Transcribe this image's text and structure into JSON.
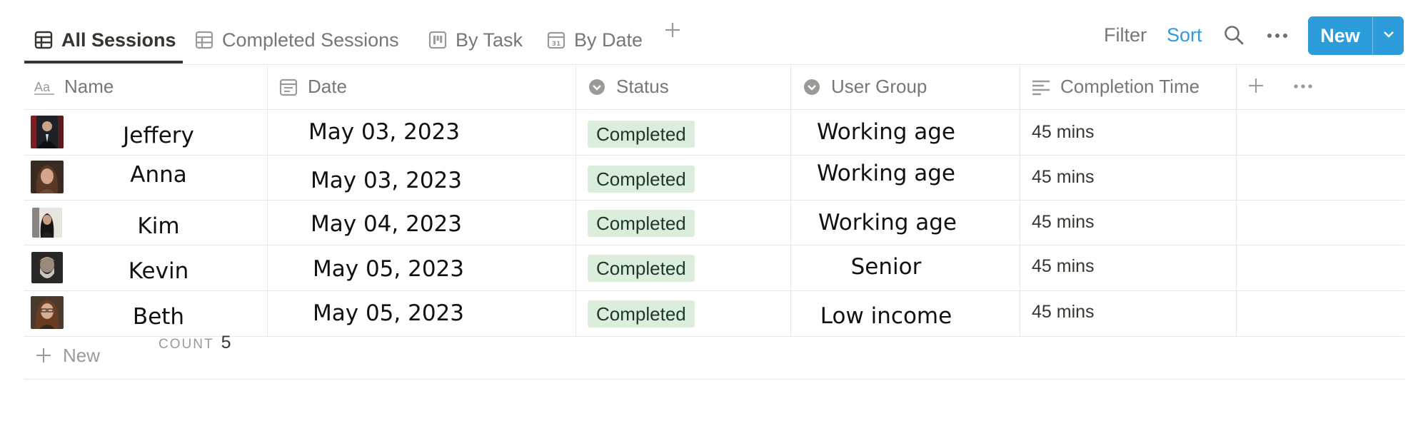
{
  "tabs": [
    {
      "label": "All Sessions",
      "icon": "table-icon",
      "active": true
    },
    {
      "label": "Completed Sessions",
      "icon": "table-icon",
      "active": false
    },
    {
      "label": "By Task",
      "icon": "board-icon",
      "active": false
    },
    {
      "label": "By Date",
      "icon": "calendar-icon",
      "active": false
    }
  ],
  "toolbar": {
    "filter_label": "Filter",
    "sort_label": "Sort",
    "new_label": "New",
    "search_icon": "search-icon",
    "more_icon": "more-icon"
  },
  "columns": [
    {
      "label": "Name",
      "icon": "text-property-icon"
    },
    {
      "label": "Date",
      "icon": "date-property-icon"
    },
    {
      "label": "Status",
      "icon": "status-property-icon"
    },
    {
      "label": "User Group",
      "icon": "select-property-icon"
    },
    {
      "label": "Completion Time",
      "icon": "text-lines-icon"
    }
  ],
  "rows": [
    {
      "name": "Jeffery",
      "date": "May 03, 2023",
      "status": "Completed",
      "user_group": "Working age",
      "completion_time": "45 mins"
    },
    {
      "name": "Anna",
      "date": "May 03, 2023",
      "status": "Completed",
      "user_group": "Working age",
      "completion_time": "45 mins"
    },
    {
      "name": "Kim",
      "date": "May 04, 2023",
      "status": "Completed",
      "user_group": "Working age",
      "completion_time": "45 mins"
    },
    {
      "name": "Kevin",
      "date": "May 05, 2023",
      "status": "Completed",
      "user_group": "Senior",
      "completion_time": "45 mins"
    },
    {
      "name": "Beth",
      "date": "May 05, 2023",
      "status": "Completed",
      "user_group": "Low income",
      "completion_time": "45 mins"
    }
  ],
  "new_row_label": "New",
  "footer": {
    "count_label": "COUNT",
    "count_value": "5"
  },
  "colors": {
    "accent": "#2d9cdb",
    "sort_active": "#2d9cdb",
    "status_completed_bg": "#dbeddb",
    "status_completed_text": "#1c3829",
    "text_primary": "#37352f",
    "text_muted": "#787774",
    "border": "#e9e9e7"
  }
}
